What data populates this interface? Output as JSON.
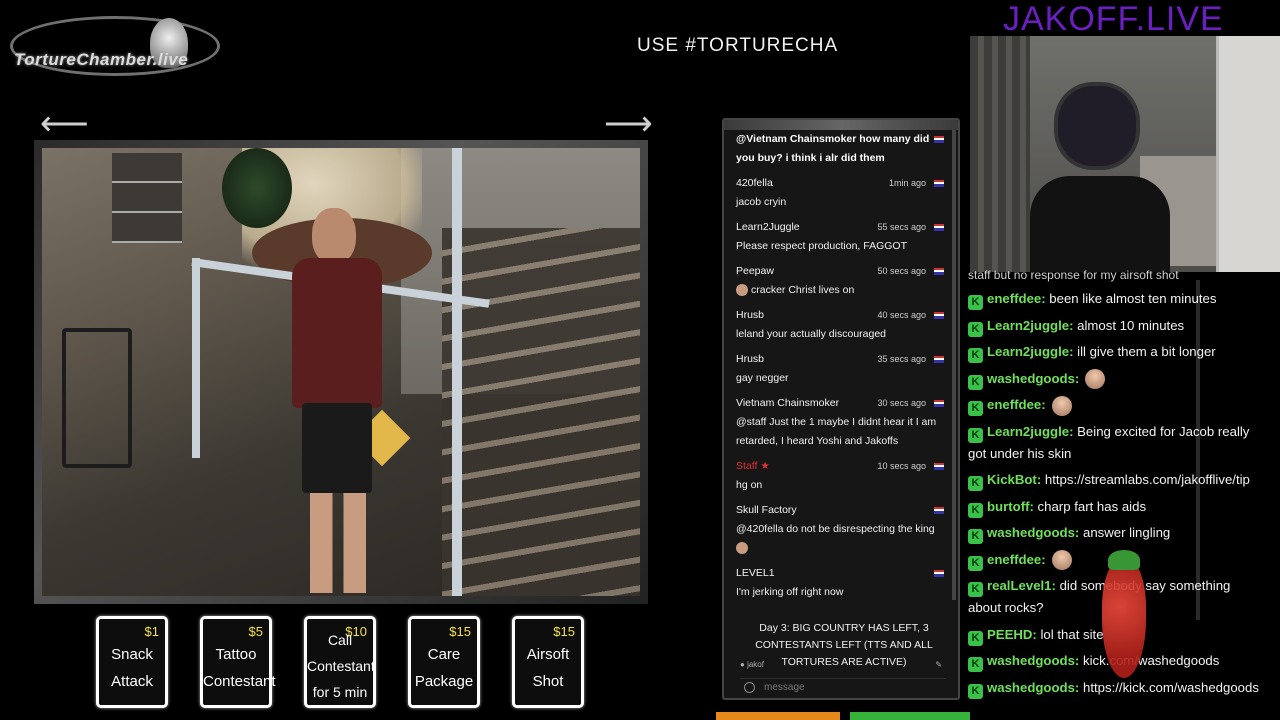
{
  "header": {
    "logo_text": "TortureChamber.live",
    "ticker": "USE #TORTURECHA",
    "brand": "JAKOFF.LIVE"
  },
  "nav": {
    "prev_arrow": "⟵",
    "next_arrow": "⟶"
  },
  "tiles": [
    {
      "price": "$1",
      "line1": "Snack",
      "line2": "Attack",
      "line3": ""
    },
    {
      "price": "$5",
      "line1": "Tattoo",
      "line2": "Contestant",
      "line3": ""
    },
    {
      "price": "$10",
      "line1": "Call",
      "line2": "Contestant",
      "line3": "for 5 min"
    },
    {
      "price": "$15",
      "line1": "Care",
      "line2": "Package",
      "line3": ""
    },
    {
      "price": "$15",
      "line1": "Airsoft",
      "line2": "Shot",
      "line3": ""
    }
  ],
  "left_chat": {
    "messages": [
      {
        "name": "",
        "time": "",
        "text": "@Vietnam Chainsmoker how many did you buy? i think i alr did them"
      },
      {
        "name": "420fella",
        "time": "1min ago",
        "text": "jacob cryin"
      },
      {
        "name": "Learn2Juggle",
        "time": "55 secs ago",
        "text": "Please respect production, FAGGOT"
      },
      {
        "name": "Peepaw",
        "time": "50 secs ago",
        "text": "cracker Christ lives on"
      },
      {
        "name": "Hrusb",
        "time": "40 secs ago",
        "text": "leland your actually discouraged"
      },
      {
        "name": "Hrusb",
        "time": "35 secs ago",
        "text": "gay negger"
      },
      {
        "name": "Vietnam Chainsmoker",
        "time": "30 secs ago",
        "text": "@staff Just the 1 maybe I didnt hear it I am retarded, I heard Yoshi and Jakoffs"
      },
      {
        "name": "Staff",
        "time": "10 secs ago",
        "text": "hg on"
      },
      {
        "name": "Skull Factory",
        "time": "",
        "text": "@420fella do not be disrespecting the king"
      },
      {
        "name": "LEVEL1",
        "time": "",
        "text": "I'm jerking off right now"
      }
    ],
    "announcement": "Day 3: BIG COUNTRY HAS LEFT, 3 CONTESTANTS LEFT (TTS AND ALL TORTURES ARE ACTIVE)",
    "footer_user": "jakof",
    "input_placeholder": "message"
  },
  "right_chat": {
    "top_line": "staff but no response for my airsoft shot",
    "messages": [
      {
        "user": "eneffdee:",
        "text": "been like almost ten minutes",
        "emote": false
      },
      {
        "user": "Learn2juggle:",
        "text": "almost 10 minutes",
        "emote": false
      },
      {
        "user": "Learn2juggle:",
        "text": "ill give them a bit longer",
        "emote": false
      },
      {
        "user": "washedgoods:",
        "text": "",
        "emote": true
      },
      {
        "user": "eneffdee:",
        "text": "",
        "emote": true
      },
      {
        "user": "Learn2juggle:",
        "text": "Being excited for Jacob really got under his skin",
        "emote": false
      },
      {
        "user": "KickBot:",
        "text": "https://streamlabs.com/jakofflive/tip",
        "emote": false
      },
      {
        "user": "burtoff:",
        "text": "charp fart has aids",
        "emote": false
      },
      {
        "user": "washedgoods:",
        "text": "answer lingling",
        "emote": false
      },
      {
        "user": "eneffdee:",
        "text": "",
        "emote": true
      },
      {
        "user": "realLevel1:",
        "text": "did somebody say something about rocks?",
        "emote": false
      },
      {
        "user": "PEEHD:",
        "text": "lol that site",
        "emote": false
      },
      {
        "user": "washedgoods:",
        "text": "kick.com/washedgoods",
        "emote": false
      },
      {
        "user": "washedgoods:",
        "text": "https://kick.com/washedgoods",
        "emote": false
      }
    ]
  },
  "colors": {
    "brand": "#6b1fc2",
    "kick_green": "#39c14a",
    "username_green": "#6ee05a",
    "price_yellow": "#f3e24a"
  }
}
